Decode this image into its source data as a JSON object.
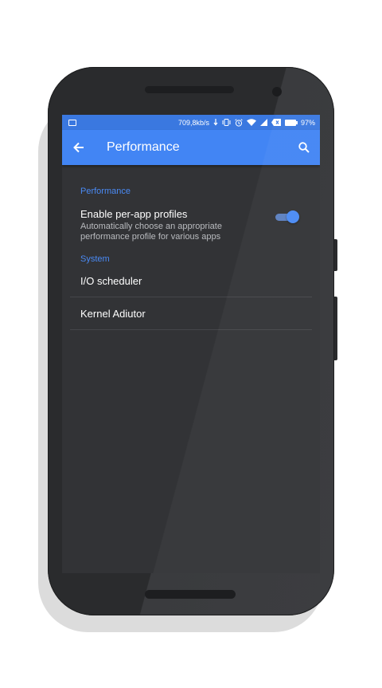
{
  "status_bar": {
    "net_speed": "709,8kb/s",
    "battery": "97%",
    "icons": [
      "image-icon",
      "download-icon",
      "vibrate-icon",
      "alarm-icon",
      "wifi-icon",
      "signal-icon",
      "no-sim-icon",
      "battery-icon"
    ]
  },
  "toolbar": {
    "title": "Performance",
    "back_icon": "arrow-back-icon",
    "search_icon": "search-icon"
  },
  "sections": {
    "performance": {
      "header": "Performance",
      "per_app": {
        "title": "Enable per-app profiles",
        "summary_line1": "Automatically choose an appropriate",
        "summary_line2": "performance profile for various apps",
        "enabled": true
      }
    },
    "system": {
      "header": "System",
      "items": [
        "I/O scheduler",
        "Kernel Adiutor"
      ]
    }
  },
  "colors": {
    "accent": "#4285f4",
    "status_bar": "#3a78e0",
    "background": "#323336"
  }
}
